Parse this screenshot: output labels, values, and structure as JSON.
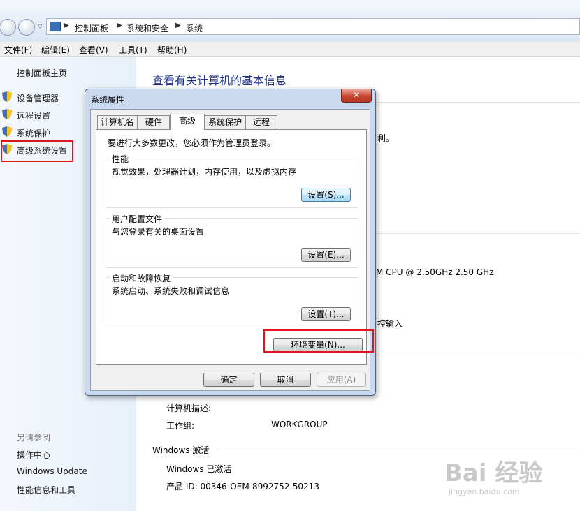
{
  "breadcrumb": [
    "控制面板",
    "系统和安全",
    "系统"
  ],
  "menu": [
    "文件(F)",
    "编辑(E)",
    "查看(V)",
    "工具(T)",
    "帮助(H)"
  ],
  "sidebar": {
    "home": "控制面板主页",
    "links": [
      "设备管理器",
      "远程设置",
      "系统保护",
      "高级系统设置"
    ],
    "see_also_heading": "另请参阅",
    "see_also": [
      "操作中心",
      "Windows Update",
      "性能信息和工具"
    ]
  },
  "main": {
    "heading": "查看有关计算机的基本信息",
    "fragment_rights": "利。",
    "fragment_cpu": "M CPU @ 2.50GHz   2.50 GHz",
    "fragment_touch": "控输入",
    "computer_desc_label": "计算机描述:",
    "workgroup_label": "工作组:",
    "workgroup_value": "WORKGROUP",
    "activation_heading": "Windows 激活",
    "activation_status": "Windows 已激活",
    "product_id": "产品 ID: 00346-OEM-8992752-50213"
  },
  "dialog": {
    "title": "系统属性",
    "close": "✕",
    "tabs": [
      "计算机名",
      "硬件",
      "高级",
      "系统保护",
      "远程"
    ],
    "selected_tab": "高级",
    "admin_note": "要进行大多数更改，您必须作为管理员登录。",
    "performance": {
      "label": "性能",
      "desc": "视觉效果，处理器计划，内存使用，以及虚拟内存",
      "button": "设置(S)..."
    },
    "profiles": {
      "label": "用户配置文件",
      "desc": "与您登录有关的桌面设置",
      "button": "设置(E)..."
    },
    "startup": {
      "label": "启动和故障恢复",
      "desc": "系统启动、系统失败和调试信息",
      "button": "设置(T)..."
    },
    "env_button": "环境变量(N)...",
    "ok": "确定",
    "cancel": "取消",
    "apply": "应用(A)"
  },
  "watermark": {
    "text": "Bai 经验",
    "url": "jingyan.baidu.com"
  },
  "colors": {
    "highlight": "#e3141b",
    "heading": "#1e3287",
    "link": "#1a1a1a"
  }
}
